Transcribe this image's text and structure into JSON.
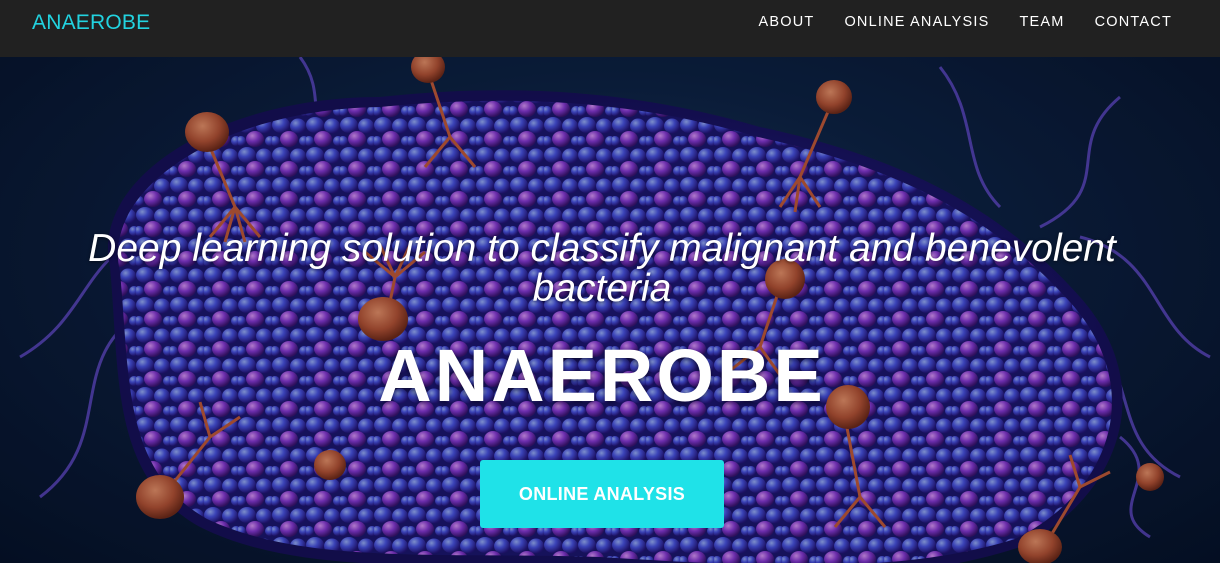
{
  "navbar": {
    "brand": "ANAEROBE",
    "links": [
      "ABOUT",
      "ONLINE ANALYSIS",
      "TEAM",
      "CONTACT"
    ]
  },
  "hero": {
    "tagline": "Deep learning solution to classify malignant and benevolent bacteria",
    "title": "ANAEROBE",
    "cta_label": "ONLINE ANALYSIS",
    "image": "bacteria-colony-illustration"
  },
  "colors": {
    "navbar_bg": "#212121",
    "brand_accent": "#22d3e0",
    "cta_bg": "#1fe2e8",
    "hero_bg": "#0c2143"
  }
}
